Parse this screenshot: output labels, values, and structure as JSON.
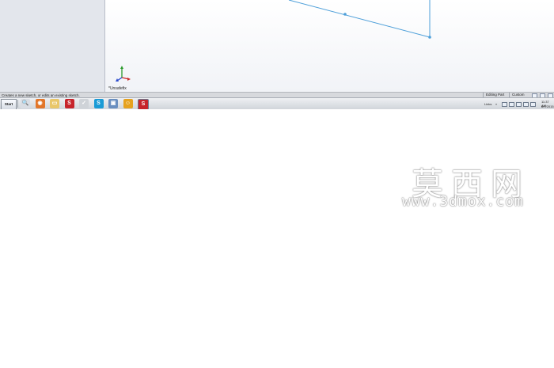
{
  "part_name": "*Unsafefix",
  "status_bar": {
    "message": "Creates a new sketch, or edits an existing sketch.",
    "mode": "Editing Part",
    "units": "Custom"
  },
  "taskbar": {
    "start_label": "Start",
    "icons": [
      {
        "name": "search-icon",
        "glyph": "🔍",
        "color": "#d9dde3"
      },
      {
        "name": "firefox-icon",
        "glyph": "◉",
        "color": "#e2762a"
      },
      {
        "name": "folder-icon",
        "glyph": "▭",
        "color": "#e9c76a"
      },
      {
        "name": "solidworks-icon",
        "glyph": "S",
        "color": "#c7242b"
      },
      {
        "name": "check-icon",
        "glyph": "✓",
        "color": "#cfd3d8"
      },
      {
        "name": "skype-icon",
        "glyph": "S",
        "color": "#1a9bd6"
      },
      {
        "name": "monitor-icon",
        "glyph": "▣",
        "color": "#6a8fc0"
      },
      {
        "name": "chat-icon",
        "glyph": "☺",
        "color": "#e6a21f"
      },
      {
        "name": "solidworks-active-icon",
        "glyph": "S",
        "color": "#c7242b"
      }
    ],
    "tray_links": "Links",
    "tray_arrow": "»",
    "clock_time": "11:37 AM",
    "clock_date": "8/7/2015"
  },
  "watermark": {
    "text_cn": "莫西网",
    "url": "www.3dmox.com"
  },
  "colors": {
    "sketch_line": "#4d9fd9",
    "panel_bg": "#e3e6ec"
  }
}
